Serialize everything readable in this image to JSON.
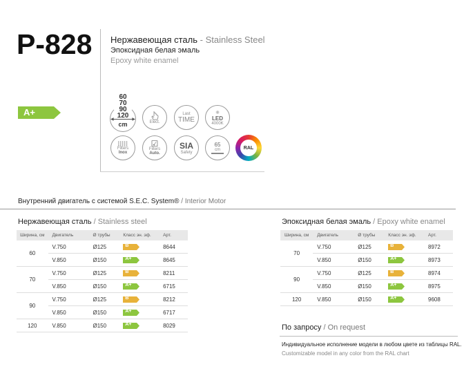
{
  "model": "P-828",
  "material": {
    "line1_ru": "Нержавеющая сталь",
    "line1_en": "- Stainless Steel",
    "line2": "Эпоксидная белая эмаль",
    "line3": "Epoxy white enamel"
  },
  "energy_class": "A+",
  "colors": {
    "class_b": "#e8b23a",
    "class_aplus": "#8dc63f",
    "header_bg": "#e8e8e8"
  },
  "icons": {
    "sizes": [
      "60",
      "70",
      "90",
      "120"
    ],
    "sizes_unit": "cm",
    "elect": "Elect.",
    "last_top": "Last",
    "last_bottom": "TIME",
    "led_top": "LED",
    "led_bottom": "4000K",
    "filters1_top": "Filters",
    "filters1_bottom": "Inox",
    "filters2_top": "Filters",
    "filters2_bottom": "Auto.",
    "sia_top": "SIA",
    "sia_bottom": "Safety",
    "height_value": "65",
    "height_unit": "cm",
    "ral": "RAL"
  },
  "section": {
    "title_ru": "Внутренний двигатель с системой S.E.C. System®",
    "title_en": "/ Interior Motor"
  },
  "table_left": {
    "title_ru": "Нержавеющая сталь",
    "title_en": "/ Stainless steel",
    "headers": [
      "Ширина, см",
      "Двигатель",
      "Ø трубы",
      "Класс эн. эф.",
      "Арт."
    ],
    "groups": [
      {
        "width": "60",
        "rows": [
          {
            "motor": "V.750",
            "pipe": "Ø125",
            "cls": "B",
            "art": "8644"
          },
          {
            "motor": "V.850",
            "pipe": "Ø150",
            "cls": "A+",
            "art": "8645"
          }
        ]
      },
      {
        "width": "70",
        "rows": [
          {
            "motor": "V.750",
            "pipe": "Ø125",
            "cls": "B",
            "art": "8211"
          },
          {
            "motor": "V.850",
            "pipe": "Ø150",
            "cls": "A+",
            "art": "6715"
          }
        ]
      },
      {
        "width": "90",
        "rows": [
          {
            "motor": "V.750",
            "pipe": "Ø125",
            "cls": "B",
            "art": "8212"
          },
          {
            "motor": "V.850",
            "pipe": "Ø150",
            "cls": "A+",
            "art": "6717"
          }
        ]
      },
      {
        "width": "120",
        "rows": [
          {
            "motor": "V.850",
            "pipe": "Ø150",
            "cls": "A+",
            "art": "8029"
          }
        ]
      }
    ]
  },
  "table_right": {
    "title_ru": "Эпоксидная белая эмаль",
    "title_en": "/ Epoxy white enamel",
    "headers": [
      "Ширина, см",
      "Двигатель",
      "Ø трубы",
      "Класс эн. эф.",
      "Арт."
    ],
    "groups": [
      {
        "width": "70",
        "rows": [
          {
            "motor": "V.750",
            "pipe": "Ø125",
            "cls": "B",
            "art": "8972"
          },
          {
            "motor": "V.850",
            "pipe": "Ø150",
            "cls": "A+",
            "art": "8973"
          }
        ]
      },
      {
        "width": "90",
        "rows": [
          {
            "motor": "V.750",
            "pipe": "Ø125",
            "cls": "B",
            "art": "8974"
          },
          {
            "motor": "V.850",
            "pipe": "Ø150",
            "cls": "A+",
            "art": "8975"
          }
        ]
      },
      {
        "width": "120",
        "rows": [
          {
            "motor": "V.850",
            "pipe": "Ø150",
            "cls": "A+",
            "art": "9608"
          }
        ]
      }
    ]
  },
  "on_request": {
    "title_ru": "По запросу",
    "title_en": "/ On request",
    "line1": "Индивидуальное исполнение модели в любом цвете из таблицы RAL.",
    "line2": "Customizable model in any color from the RAL chart"
  }
}
